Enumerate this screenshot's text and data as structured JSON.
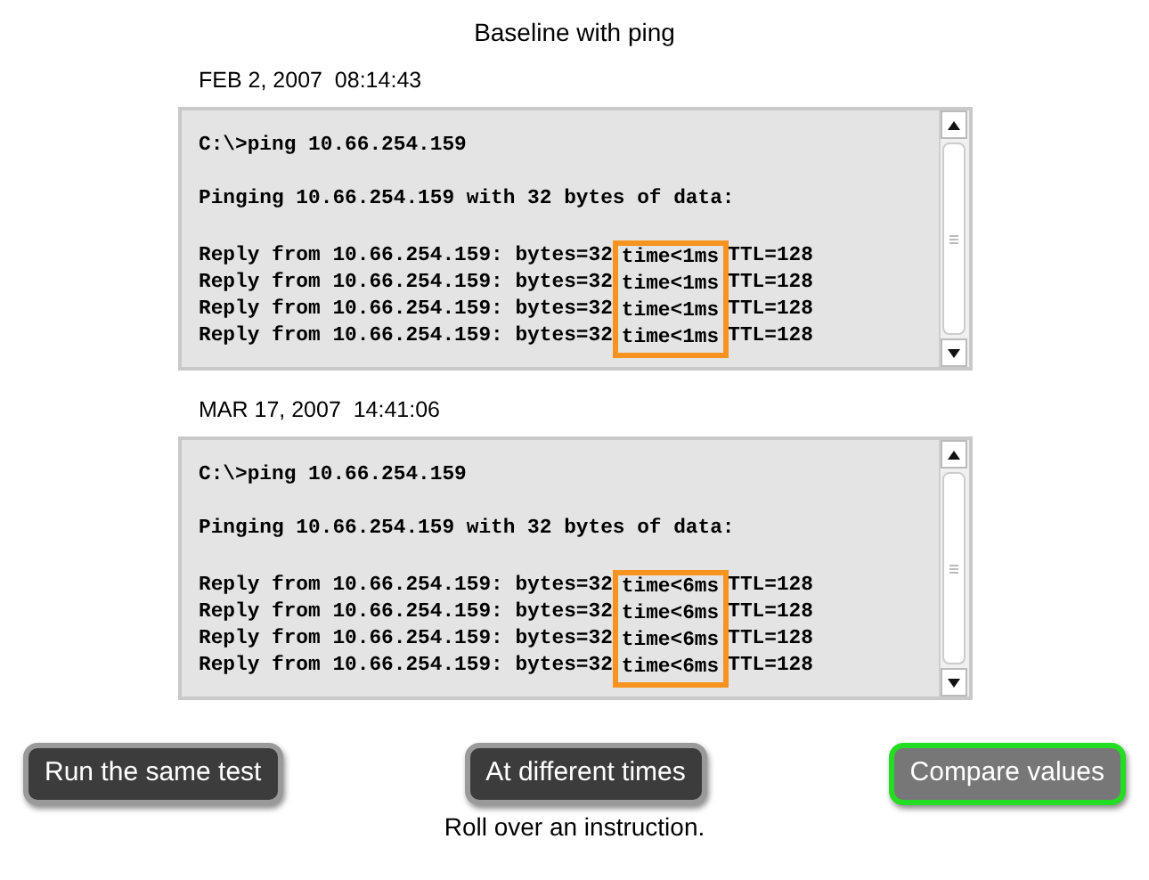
{
  "title": "Baseline with ping",
  "panels": [
    {
      "timestamp": "FEB 2, 2007  08:14:43",
      "command": "C:\\>ping 10.66.254.159",
      "pinging": "Pinging 10.66.254.159 with 32 bytes of data:",
      "highlighted": true,
      "replies": [
        {
          "prefix": "Reply from 10.66.254.159: bytes=32",
          "time": "time<1ms",
          "ttl": "TTL=128"
        },
        {
          "prefix": "Reply from 10.66.254.159: bytes=32",
          "time": "time<1ms",
          "ttl": "TTL=128"
        },
        {
          "prefix": "Reply from 10.66.254.159: bytes=32",
          "time": "time<1ms",
          "ttl": "TTL=128"
        },
        {
          "prefix": "Reply from 10.66.254.159: bytes=32",
          "time": "time<1ms",
          "ttl": "TTL=128"
        }
      ]
    },
    {
      "timestamp": "MAR 17, 2007  14:41:06",
      "command": "C:\\>ping 10.66.254.159",
      "pinging": "Pinging 10.66.254.159 with 32 bytes of data:",
      "highlighted": true,
      "replies": [
        {
          "prefix": "Reply from 10.66.254.159: bytes=32",
          "time": "time<6ms",
          "ttl": "TTL=128"
        },
        {
          "prefix": "Reply from 10.66.254.159: bytes=32",
          "time": "time<6ms",
          "ttl": "TTL=128"
        },
        {
          "prefix": "Reply from 10.66.254.159: bytes=32",
          "time": "time<6ms",
          "ttl": "TTL=128"
        },
        {
          "prefix": "Reply from 10.66.254.159: bytes=32",
          "time": "time<6ms",
          "ttl": "TTL=128"
        }
      ]
    }
  ],
  "buttons": [
    {
      "label": "Run the same test",
      "selected": false
    },
    {
      "label": "At different times",
      "selected": false
    },
    {
      "label": "Compare values",
      "selected": true
    }
  ],
  "instruction": "Roll over an instruction."
}
